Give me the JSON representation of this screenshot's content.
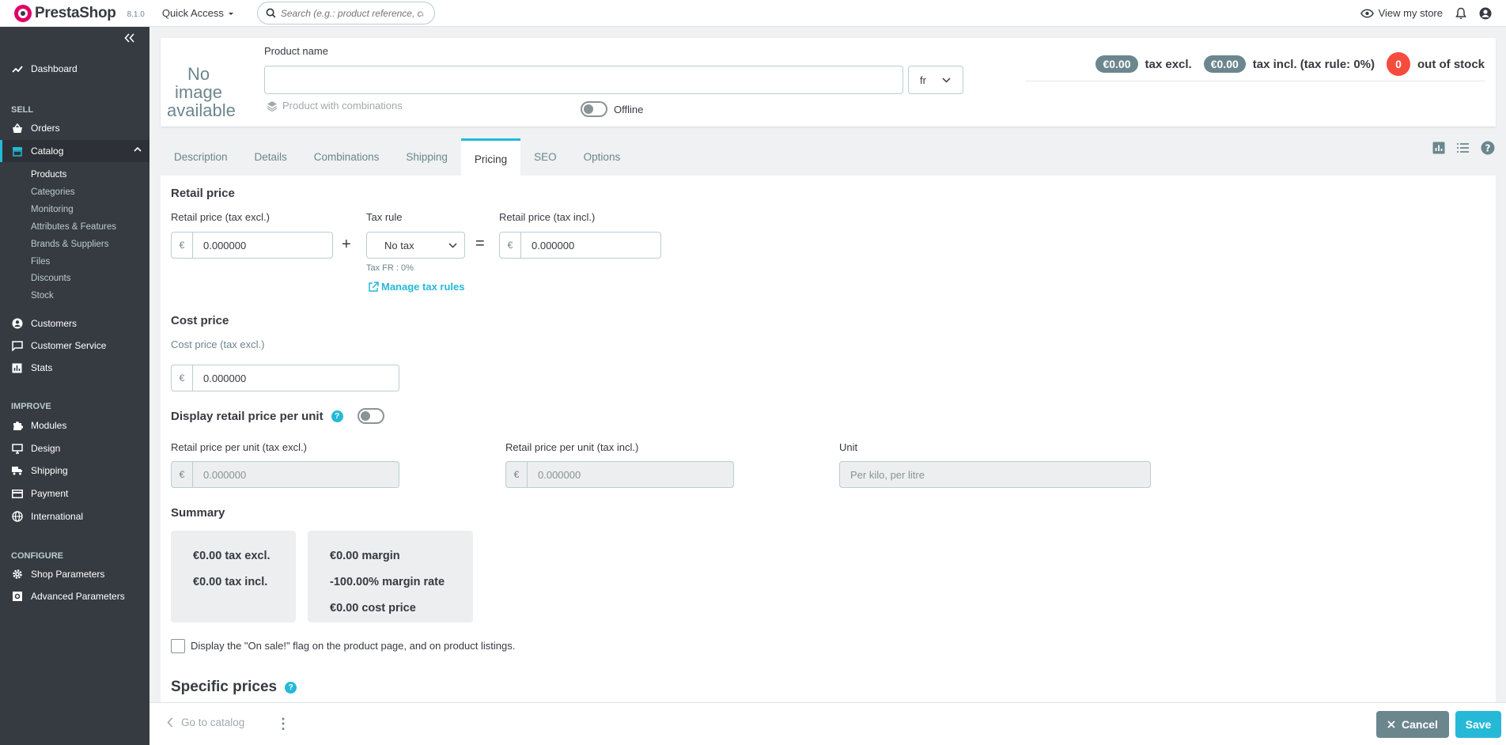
{
  "topbar": {
    "brand": "PrestaShop",
    "version": "8.1.0",
    "quick_access": "Quick Access",
    "search_placeholder": "Search (e.g.: product reference, custon",
    "view_store": "View my store"
  },
  "sidebar": {
    "dashboard": "Dashboard",
    "section_sell": "SELL",
    "orders": "Orders",
    "catalog": "Catalog",
    "catalog_sub": [
      "Products",
      "Categories",
      "Monitoring",
      "Attributes & Features",
      "Brands & Suppliers",
      "Files",
      "Discounts",
      "Stock"
    ],
    "customers": "Customers",
    "customer_service": "Customer Service",
    "stats": "Stats",
    "section_improve": "IMPROVE",
    "modules": "Modules",
    "design": "Design",
    "shipping": "Shipping",
    "payment": "Payment",
    "international": "International",
    "section_configure": "CONFIGURE",
    "shop_parameters": "Shop Parameters",
    "advanced_parameters": "Advanced Parameters"
  },
  "product_header": {
    "no_image": "No image available",
    "name_label": "Product name",
    "name_value": "",
    "language": "fr",
    "combinations_label": "Product with combinations",
    "status_label": "Offline",
    "price_excl": "€0.00",
    "price_excl_label": "tax excl.",
    "price_incl": "€0.00",
    "price_incl_label": "tax incl. (tax rule: 0%)",
    "stock": "0",
    "stock_label": "out of stock"
  },
  "tabs": [
    "Description",
    "Details",
    "Combinations",
    "Shipping",
    "Pricing",
    "SEO",
    "Options"
  ],
  "active_tab": "Pricing",
  "pricing": {
    "retail_title": "Retail price",
    "retail_excl_label": "Retail price (tax excl.)",
    "currency": "€",
    "retail_excl_value": "0.000000",
    "plus": "+",
    "tax_rule_label": "Tax rule",
    "tax_rule_value": "No tax",
    "tax_hint": "Tax FR : 0%",
    "manage_tax": "Manage tax rules",
    "equals": "=",
    "retail_incl_label": "Retail price (tax incl.)",
    "retail_incl_value": "0.000000",
    "cost_title": "Cost price",
    "cost_label": "Cost price (tax excl.)",
    "cost_value": "0.000000",
    "unit_title": "Display retail price per unit",
    "unit_excl_label": "Retail price per unit (tax excl.)",
    "unit_excl_placeholder": "0.000000",
    "unit_incl_label": "Retail price per unit (tax incl.)",
    "unit_incl_placeholder": "0.000000",
    "unit_label": "Unit",
    "unit_placeholder": "Per kilo, per litre",
    "summary_title": "Summary",
    "summary_left": [
      "€0.00 tax excl.",
      "€0.00 tax incl."
    ],
    "summary_right": [
      "€0.00 margin",
      "-100.00% margin rate",
      "€0.00 cost price"
    ],
    "on_sale_label": "Display the \"On sale!\" flag on the product page, and on product listings.",
    "specific_title": "Specific prices"
  },
  "footer": {
    "go_to_catalog": "Go to catalog",
    "cancel": "Cancel",
    "save": "Save"
  },
  "colors": {
    "accent": "#25b9d7",
    "sidebar_bg": "#363a41",
    "danger": "#f54c3e",
    "muted": "#6c868e"
  }
}
